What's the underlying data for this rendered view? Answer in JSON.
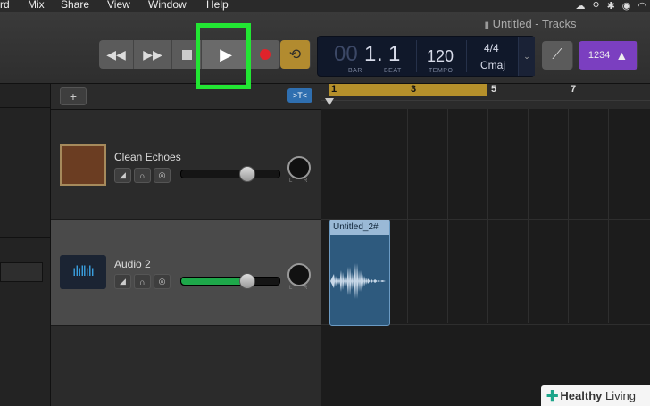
{
  "menubar": {
    "items": [
      "rd",
      "Mix",
      "Share",
      "View",
      "Window",
      "Help"
    ]
  },
  "window": {
    "title": "Untitled - Tracks"
  },
  "transport": {
    "rewind_icon": "rewind-icon",
    "forward_icon": "fast-forward-icon",
    "stop_icon": "stop-icon",
    "play_icon": "play-icon",
    "record_icon": "record-icon",
    "cycle_icon": "cycle-icon"
  },
  "lcd": {
    "bar_faded": "00",
    "bar": "1",
    "beat": "1",
    "bar_label": "BAR",
    "beat_label": "BEAT",
    "tempo": "120",
    "tempo_label": "TEMPO",
    "signature": "4/4",
    "key": "Cmaj"
  },
  "count_in": {
    "label": "1234"
  },
  "tracks_header": {
    "add": "+"
  },
  "ruler": {
    "marks": [
      "1",
      "3",
      "5",
      "7"
    ]
  },
  "tracks": [
    {
      "name": "Clean Echoes",
      "volume": 0.62,
      "type": "amp-icon",
      "active": false
    },
    {
      "name": "Audio 2",
      "volume": 0.62,
      "type": "waveform-icon",
      "active": true
    }
  ],
  "pan_labels": {
    "left": "L",
    "right": "R"
  },
  "region": {
    "name": "Untitled_2#"
  },
  "watermark": {
    "brand": "Healthy",
    "suffix": " Living"
  },
  "colors": {
    "highlight": "#22e633",
    "region_ruler": "#b5902b",
    "clip": "#2e5a7e",
    "volume_active": "#1ea84a"
  }
}
